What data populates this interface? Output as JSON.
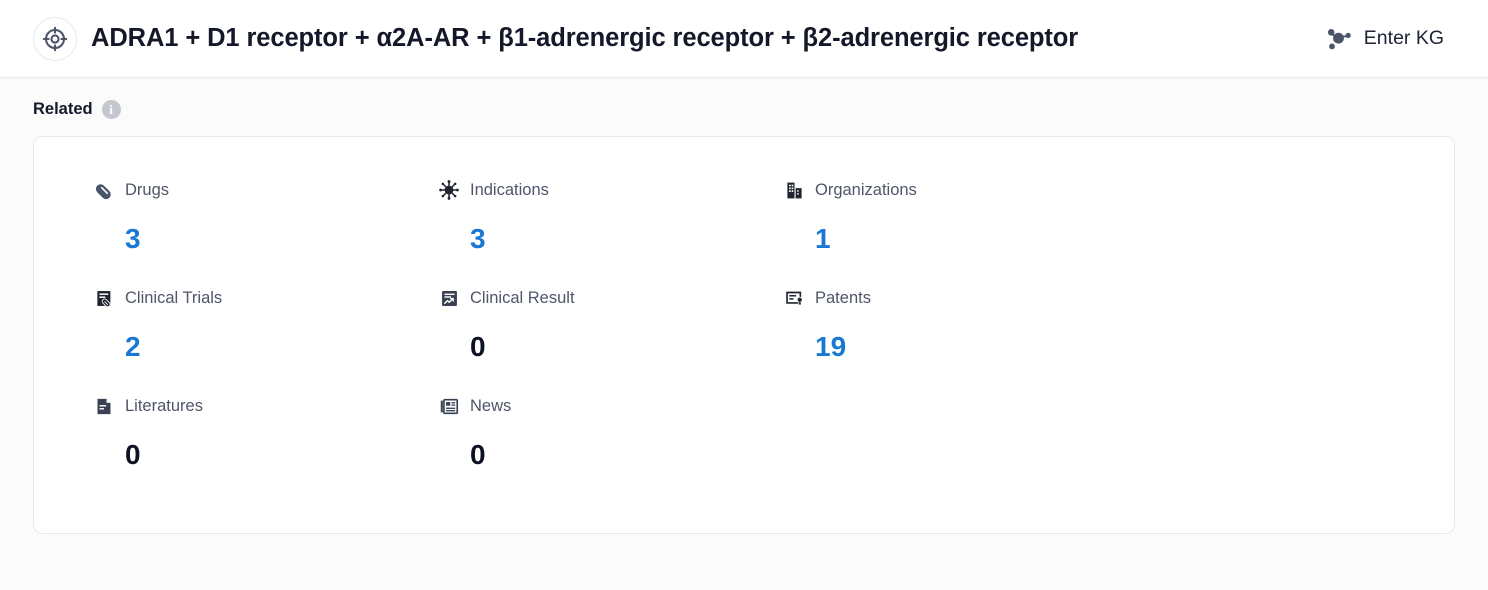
{
  "header": {
    "entity_icon": "target-crosshair-icon",
    "title": "ADRA1 + D1 receptor + α2A-AR + β1-adrenergic receptor + β2-adrenergic receptor",
    "kg_icon": "knowledge-graph-icon",
    "kg_label": "Enter KG"
  },
  "related": {
    "section_title": "Related",
    "info_icon": "info-icon",
    "info_glyph": "i",
    "items": [
      {
        "icon": "pill-icon",
        "label": "Drugs",
        "value": "3",
        "is_zero": false
      },
      {
        "icon": "virus-icon",
        "label": "Indications",
        "value": "3",
        "is_zero": false
      },
      {
        "icon": "building-icon",
        "label": "Organizations",
        "value": "1",
        "is_zero": false
      },
      {
        "icon": "clinical-trial-icon",
        "label": "Clinical Trials",
        "value": "2",
        "is_zero": false
      },
      {
        "icon": "chart-report-icon",
        "label": "Clinical Result",
        "value": "0",
        "is_zero": true
      },
      {
        "icon": "patent-award-icon",
        "label": "Patents",
        "value": "19",
        "is_zero": false
      },
      {
        "icon": "document-icon",
        "label": "Literatures",
        "value": "0",
        "is_zero": true
      },
      {
        "icon": "newspaper-icon",
        "label": "News",
        "value": "0",
        "is_zero": true
      }
    ]
  },
  "colors": {
    "accent_blue": "#1878d4",
    "zero_dark": "#0d1323",
    "icon_slate": "#4b5468",
    "label_gray": "#4e5668",
    "title_dark": "#141829",
    "card_border": "#e8e9ef",
    "page_bg": "#fbfbfc"
  }
}
